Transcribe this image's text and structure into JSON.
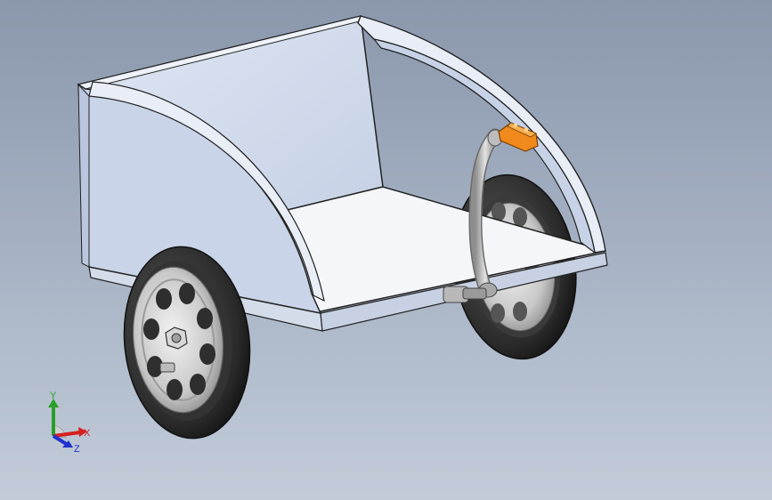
{
  "viewport": {
    "background_top": "#8a97ac",
    "background_bottom": "#c2ccd9"
  },
  "model": {
    "body_color": "#ccd7ea",
    "floor_color": "#f2f4f8",
    "tire_color": "#2b2b2b",
    "rim_color": "#cfcfcf",
    "pedal_color": "#f08a1c"
  },
  "triad": {
    "x_label": "X",
    "y_label": "Y",
    "z_label": "Z",
    "x_color": "#d42020",
    "y_color": "#28a028",
    "z_color": "#2030d0"
  }
}
